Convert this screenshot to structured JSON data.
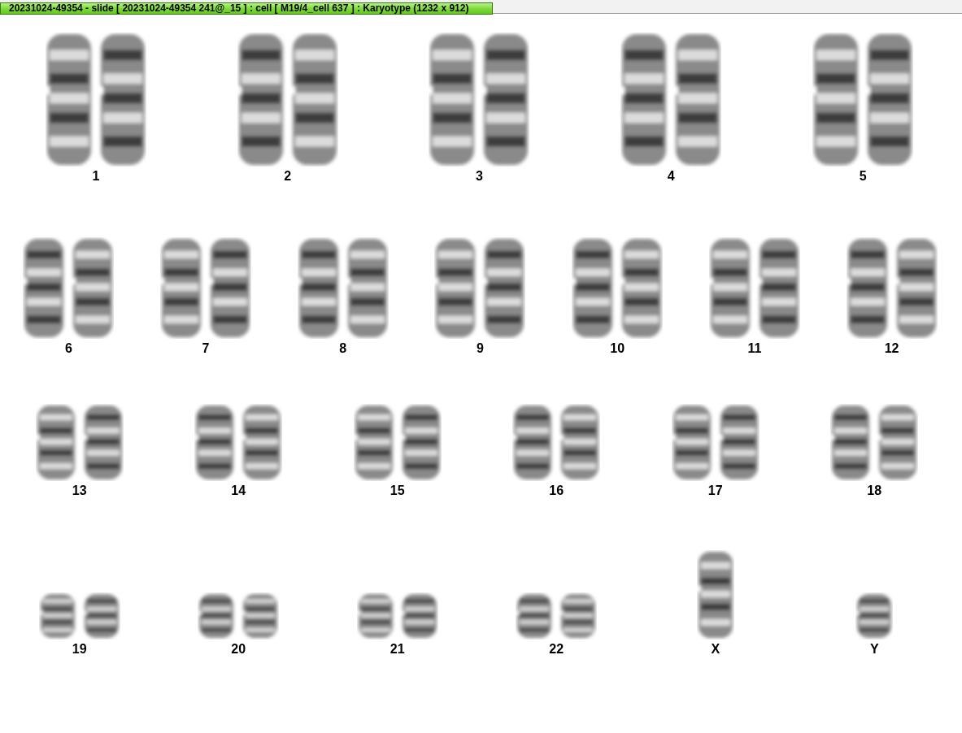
{
  "title_tab": "20231024-49354 - slide [ 20231024-49354 241@_15 ] : cell [ M19/4_cell 637 ] : Karyotype  (1232 x 912)",
  "karyotype": {
    "rows": [
      {
        "chromosomes": [
          {
            "label": "1",
            "kind": "pair"
          },
          {
            "label": "2",
            "kind": "pair"
          },
          {
            "label": "3",
            "kind": "pair"
          },
          {
            "label": "4",
            "kind": "pair"
          },
          {
            "label": "5",
            "kind": "pair"
          }
        ]
      },
      {
        "chromosomes": [
          {
            "label": "6",
            "kind": "pair"
          },
          {
            "label": "7",
            "kind": "pair"
          },
          {
            "label": "8",
            "kind": "pair"
          },
          {
            "label": "9",
            "kind": "pair"
          },
          {
            "label": "10",
            "kind": "pair"
          },
          {
            "label": "11",
            "kind": "pair"
          },
          {
            "label": "12",
            "kind": "pair"
          }
        ]
      },
      {
        "chromosomes": [
          {
            "label": "13",
            "kind": "pair"
          },
          {
            "label": "14",
            "kind": "pair"
          },
          {
            "label": "15",
            "kind": "pair"
          },
          {
            "label": "16",
            "kind": "pair"
          },
          {
            "label": "17",
            "kind": "pair"
          },
          {
            "label": "18",
            "kind": "pair"
          }
        ]
      },
      {
        "chromosomes": [
          {
            "label": "19",
            "kind": "pair"
          },
          {
            "label": "20",
            "kind": "pair"
          },
          {
            "label": "21",
            "kind": "pair"
          },
          {
            "label": "22",
            "kind": "pair"
          },
          {
            "label": "X",
            "kind": "single"
          },
          {
            "label": "Y",
            "kind": "single"
          }
        ]
      }
    ]
  }
}
